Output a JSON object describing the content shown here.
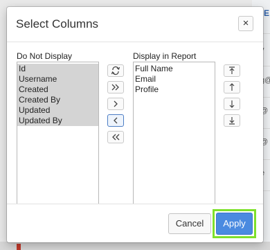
{
  "background": {
    "header_fragment": "E",
    "cells": [
      "y",
      "g@",
      "@",
      "@",
      "e"
    ]
  },
  "dialog": {
    "title": "Select Columns",
    "close_symbol": "×"
  },
  "left_list": {
    "label": "Do Not Display",
    "items": [
      "Id",
      "Username",
      "Created",
      "Created By",
      "Updated",
      "Updated By"
    ]
  },
  "right_list": {
    "label": "Display in Report",
    "items": [
      "Full Name",
      "Email",
      "Profile"
    ]
  },
  "shuttle_controls": [
    {
      "name": "reset-icon",
      "action": "Reset"
    },
    {
      "name": "move-all-right-icon",
      "action": "Move All"
    },
    {
      "name": "move-right-icon",
      "action": "Move"
    },
    {
      "name": "move-left-icon",
      "action": "Remove"
    },
    {
      "name": "move-all-left-icon",
      "action": "Remove All"
    }
  ],
  "order_controls": [
    {
      "name": "move-top-icon",
      "action": "Top"
    },
    {
      "name": "move-up-icon",
      "action": "Up"
    },
    {
      "name": "move-down-icon",
      "action": "Down"
    },
    {
      "name": "move-bottom-icon",
      "action": "Bottom"
    }
  ],
  "buttons": {
    "cancel": "Cancel",
    "apply": "Apply"
  },
  "colors": {
    "apply": "#4a8ae0",
    "highlight": "#7ee02b"
  }
}
